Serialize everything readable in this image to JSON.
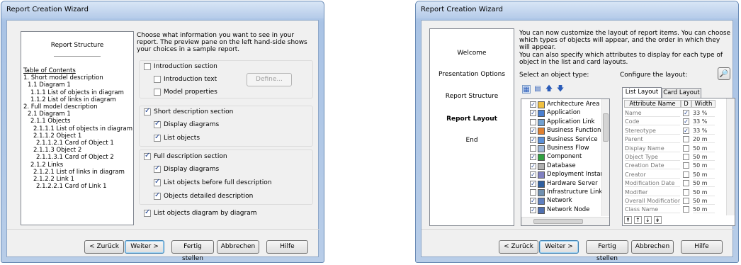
{
  "left_dialog": {
    "title": "Report Creation Wizard",
    "preview": {
      "heading": "Report Structure",
      "toc": [
        "Table of Contents",
        "1. Short model description",
        "1.1 Diagram 1",
        "1.1.1 List of objects in diagram",
        "1.1.2 List of links in diagram",
        "2. Full model description",
        "2.1 Diagram 1",
        "2.1.1 Objects",
        "2.1.1.1 List of objects in diagram",
        "2.1.1.2 Object 1",
        "2.1.1.2.1 Card of Object 1",
        "2.1.1.3 Object 2",
        "2.1.1.3.1 Card of Object 2",
        "2.1.2 Links",
        "2.1.2.1 List of links in diagram",
        "2.1.2.2 Link 1",
        "2.1.2.2.1 Card of Link 1"
      ]
    },
    "description": "Choose what information you want to see in your report. The preview pane on the left hand-side shows your choices in a sample report.",
    "intro_section": "Introduction section",
    "intro_text": "Introduction text",
    "define_button": "Define...",
    "model_properties": "Model properties",
    "short_section": "Short description section",
    "short_display_diagrams": "Display diagrams",
    "short_list_objects": "List objects",
    "full_section": "Full description section",
    "full_display_diagrams": "Display diagrams",
    "full_list_objects": "List objects before full description",
    "objects_detailed": "Objects detailed description",
    "list_by_diagram": "List objects diagram by diagram",
    "buttons": {
      "back": "< Zurück",
      "next": "Weiter >",
      "finish": "Fertig stellen",
      "cancel": "Abbrechen",
      "help": "Hilfe"
    }
  },
  "right_dialog": {
    "title": "Report Creation Wizard",
    "nav": [
      "Welcome",
      "Presentation Options",
      "Report Structure",
      "Report Layout",
      "End"
    ],
    "description1": "You can now customize the layout of report items. You can choose which types of objects will appear, and the order in which they will appear.",
    "description2": "You can also specify which attributes to display for each type of object in the list and card layouts.",
    "select_label": "Select an object type:",
    "configure_label": "Configure the layout:",
    "tree_items": [
      "Architecture Area",
      "Application",
      "Application Link",
      "Business Function",
      "Business Service",
      "Business Flow",
      "Component",
      "Database",
      "Deployment Instar",
      "Hardware Server",
      "Infrastructure Link",
      "Network",
      "Network Node"
    ],
    "tabs": [
      "List Layout",
      "Card Layout"
    ],
    "grid_headers": [
      "Attribute Name",
      "D",
      "Width"
    ],
    "grid_rows": [
      {
        "name": "Name",
        "d": true,
        "w": "33 %"
      },
      {
        "name": "Code",
        "d": true,
        "w": "33 %"
      },
      {
        "name": "Stereotype",
        "d": true,
        "w": "33 %"
      },
      {
        "name": "Parent",
        "d": false,
        "w": "20 m"
      },
      {
        "name": "Display Name",
        "d": false,
        "w": "50 m"
      },
      {
        "name": "Object Type",
        "d": false,
        "w": "50 m"
      },
      {
        "name": "Creation Date",
        "d": false,
        "w": "50 m"
      },
      {
        "name": "Creator",
        "d": false,
        "w": "50 m"
      },
      {
        "name": "Modification Date",
        "d": false,
        "w": "50 m"
      },
      {
        "name": "Modifier",
        "d": false,
        "w": "50 m"
      },
      {
        "name": "Overall Modification",
        "d": false,
        "w": "50 m"
      },
      {
        "name": "Class Name",
        "d": false,
        "w": "50 m"
      }
    ],
    "buttons": {
      "back": "< Zurück",
      "next": "Weiter >",
      "finish": "Fertig stellen",
      "cancel": "Abbrechen",
      "help": "Hilfe"
    }
  }
}
